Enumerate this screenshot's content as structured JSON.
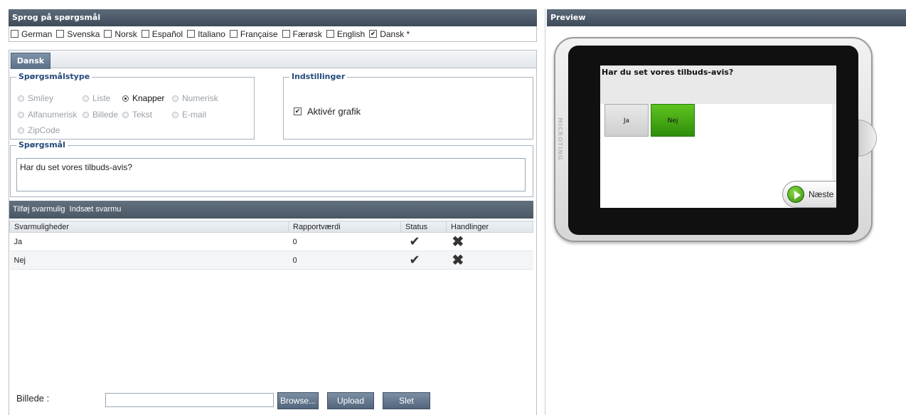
{
  "language_panel": {
    "title": "Sprog på spørgsmål",
    "languages": [
      {
        "label": "German",
        "checked": false
      },
      {
        "label": "Svenska",
        "checked": false
      },
      {
        "label": "Norsk",
        "checked": false
      },
      {
        "label": "Español",
        "checked": false
      },
      {
        "label": "Italiano",
        "checked": false
      },
      {
        "label": "Française",
        "checked": false
      },
      {
        "label": "Færøsk",
        "checked": false
      },
      {
        "label": "English",
        "checked": false
      },
      {
        "label": "Dansk *",
        "checked": true
      }
    ]
  },
  "tab": {
    "label": "Dansk"
  },
  "question_type": {
    "legend": "Spørgsmålstype",
    "options": [
      "Smiley",
      "Liste",
      "Knapper",
      "Numerisk",
      "Alfanumerisk",
      "Billede",
      "Tekst",
      "E-mail",
      "ZipCode"
    ],
    "selected": "Knapper"
  },
  "settings": {
    "legend": "Indstillinger",
    "graphics_label": "Aktivér grafik",
    "graphics_checked": true
  },
  "question": {
    "legend": "Spørgsmål",
    "text": "Har du set vores tilbuds-avis?"
  },
  "answer_toolbar": {
    "add_label": "Tilføj svarmulig",
    "insert_label": "Indsæt svarmu"
  },
  "answers_table": {
    "headers": [
      "Svarmuligheder",
      "Rapportværdi",
      "Status",
      "Handlinger"
    ],
    "rows": [
      {
        "option": "Ja",
        "value": "0"
      },
      {
        "option": "Nej",
        "value": "0"
      }
    ]
  },
  "image": {
    "label": "Billede :",
    "file_value": "",
    "browse_label": "Browse...",
    "upload_label": "Upload",
    "delete_label": "Slet"
  },
  "preview": {
    "title": "Preview",
    "brand": "MICROTING",
    "question": "Har du set vores tilbuds-avis?",
    "options": [
      {
        "label": "Ja",
        "color": "#d9d9d9"
      },
      {
        "label": "Nej",
        "color": "#3da411"
      }
    ],
    "next_label": "Næste"
  }
}
